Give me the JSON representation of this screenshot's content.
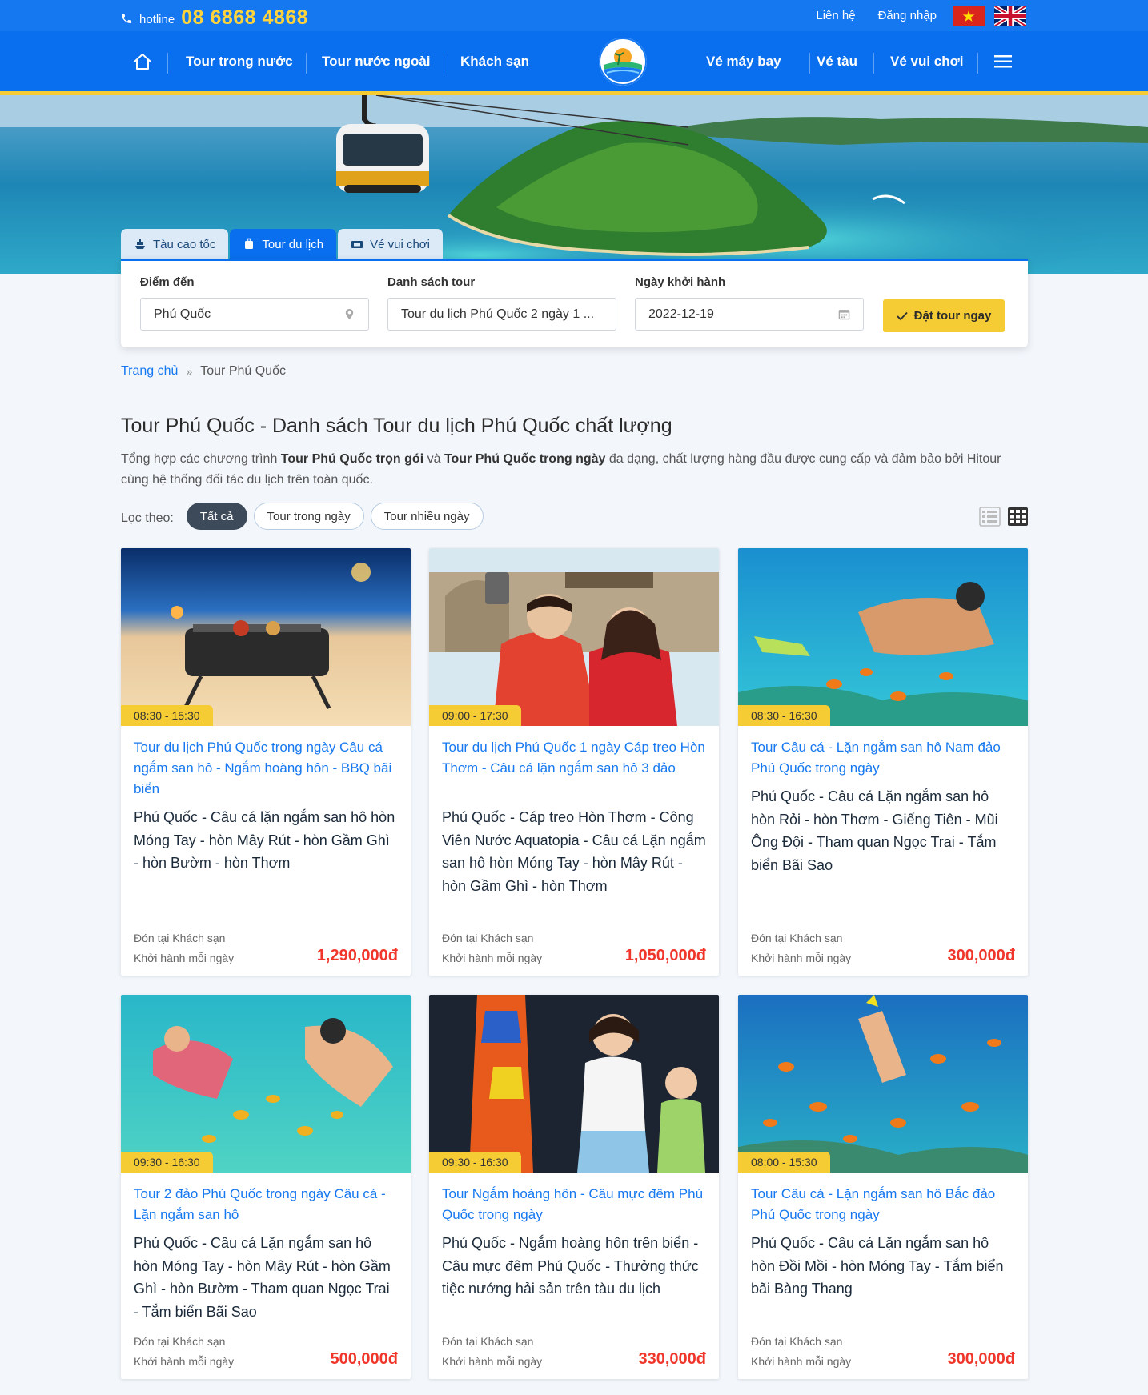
{
  "topbar": {
    "hotline_label": "hotline",
    "hotline_number": "08 6868 4868",
    "contact": "Liên hệ",
    "login": "Đăng nhập"
  },
  "nav": {
    "left": [
      "Tour trong nước",
      "Tour nước ngoài",
      "Khách sạn"
    ],
    "right": [
      "Vé máy bay",
      "Vé tàu",
      "Vé vui chơi"
    ]
  },
  "search": {
    "tabs": [
      "Tàu cao tốc",
      "Tour du lịch",
      "Vé vui chơi"
    ],
    "destination_label": "Điểm đến",
    "destination_value": "Phú Quốc",
    "tourlist_label": "Danh sách tour",
    "tourlist_value": "Tour du lịch Phú Quốc 2 ngày 1 ...",
    "date_label": "Ngày khởi hành",
    "date_value": "2022-12-19",
    "book_button": "Đặt tour ngay"
  },
  "breadcrumb": {
    "home": "Trang chủ",
    "sep": "»",
    "current": "Tour Phú Quốc"
  },
  "page": {
    "title": "Tour Phú Quốc - Danh sách Tour du lịch Phú Quốc chất lượng",
    "intro_1": "Tổng hợp các chương trình ",
    "intro_b1": "Tour Phú Quốc trọn gói",
    "intro_2": " và ",
    "intro_b2": "Tour Phú Quốc trong ngày",
    "intro_3": " đa dạng, chất lượng hàng đầu được cung cấp và đảm bảo bởi Hitour cùng hệ thống đối tác du lịch trên toàn quốc."
  },
  "filter": {
    "label": "Lọc theo:",
    "options": [
      "Tất cả",
      "Tour trong ngày",
      "Tour nhiều ngày"
    ]
  },
  "cards": [
    {
      "time": "08:30 - 15:30",
      "title": "Tour du lịch Phú Quốc trong ngày Câu cá ngắm san hô - Ngắm hoàng hôn - BBQ bãi biển",
      "desc": "Phú Quốc - Câu cá lặn ngắm san hô hòn Móng Tay - hòn Mây Rút - hòn Gầm Ghì - hòn Bườm - hòn Thơm",
      "pickup": "Đón tại Khách sạn",
      "depart": "Khởi hành mỗi ngày",
      "price": "1,290,000đ"
    },
    {
      "time": "09:00 - 17:30",
      "title": "Tour du lịch Phú Quốc 1 ngày Cáp treo Hòn Thơm - Câu cá lặn ngắm san hô 3 đảo",
      "desc": "Phú Quốc - Cáp treo Hòn Thơm - Công Viên Nước Aquatopia - Câu cá Lặn ngắm san hô hòn Móng Tay - hòn Mây Rút - hòn Gầm Ghì - hòn Thơm",
      "pickup": "Đón tại Khách sạn",
      "depart": "Khởi hành mỗi ngày",
      "price": "1,050,000đ"
    },
    {
      "time": "08:30 - 16:30",
      "title": "Tour Câu cá - Lặn ngắm san hô Nam đảo Phú Quốc trong ngày",
      "desc": "Phú Quốc - Câu cá Lặn ngắm san hô hòn Rỏi - hòn Thơm - Giếng Tiên - Mũi Ông Đội - Tham quan Ngọc Trai - Tắm biển Bãi Sao",
      "pickup": "Đón tại Khách sạn",
      "depart": "Khởi hành mỗi ngày",
      "price": "300,000đ"
    },
    {
      "time": "09:30 - 16:30",
      "title": "Tour 2 đảo Phú Quốc trong ngày Câu cá - Lặn ngắm san hô",
      "desc": "Phú Quốc - Câu cá Lặn ngắm san hô hòn Móng Tay - hòn Mây Rút - hòn Gầm Ghì - hòn Bườm - Tham quan Ngọc Trai - Tắm biển Bãi Sao",
      "pickup": "Đón tại Khách sạn",
      "depart": "Khởi hành mỗi ngày",
      "price": "500,000đ"
    },
    {
      "time": "09:30 - 16:30",
      "title": "Tour Ngắm hoàng hôn - Câu mực đêm Phú Quốc trong ngày",
      "desc": "Phú Quốc - Ngắm hoàng hôn trên biển - Câu mực đêm Phú Quốc - Thưởng thức tiệc nướng hải sản trên tàu du lịch",
      "pickup": "Đón tại Khách sạn",
      "depart": "Khởi hành mỗi ngày",
      "price": "330,000đ"
    },
    {
      "time": "08:00 - 15:30",
      "title": "Tour Câu cá - Lặn ngắm san hô Bắc đảo Phú Quốc trong ngày",
      "desc": "Phú Quốc - Câu cá Lặn ngắm san hô hòn Đồi Mồi - hòn Móng Tay - Tắm biển bãi Bàng Thang",
      "pickup": "Đón tại Khách sạn",
      "depart": "Khởi hành mỗi ngày",
      "price": "300,000đ"
    }
  ],
  "theme": {
    "primary": "#0a6fee",
    "accent": "#f6cc34",
    "price": "#f0362b",
    "link": "#1678f0"
  }
}
